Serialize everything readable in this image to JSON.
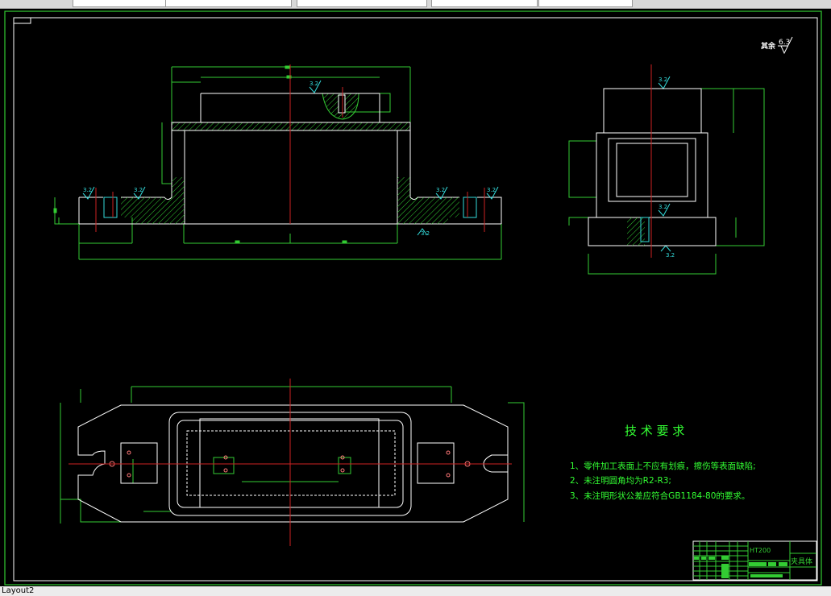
{
  "status_bar": {
    "layout_tab": "Layout2"
  },
  "drawing": {
    "roughness_note": {
      "label": "其余",
      "value": "6.3"
    },
    "roughness_marks": [
      "3.2",
      "3.2",
      "3.2",
      "3.2",
      "3.2",
      "3.2",
      "3.2",
      "3.2",
      "3.2"
    ],
    "tech_requirements": {
      "title": "技 术 要 求",
      "items": [
        "1、零件加工表面上不应有划痕，擦伤等表面缺陷;",
        "2、未注明圆角均为R2-R3;",
        "3、未注明形状公差应符合GB1184-80的要求。"
      ]
    },
    "title_block": {
      "material": "HT200",
      "part_name": "夹具体"
    },
    "colors": {
      "background": "#000000",
      "outline": "#ffffff",
      "dimension": "#33cc33",
      "centerline": "#cc2222",
      "roughness": "#33dddd",
      "text": "#33ff33"
    }
  }
}
